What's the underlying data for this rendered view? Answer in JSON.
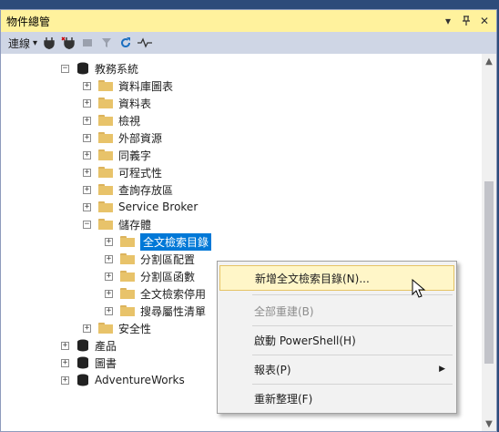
{
  "panel": {
    "title": "物件總管",
    "controls": {
      "dropdown": "▾",
      "pin": "ᵩ",
      "close": "✕"
    }
  },
  "toolbar": {
    "connect_label": "連線",
    "connect_caret": "▾"
  },
  "tree": {
    "db_name": "教務系統",
    "children": [
      "資料庫圖表",
      "資料表",
      "檢視",
      "外部資源",
      "同義字",
      "可程式性",
      "查詢存放區",
      "Service Broker"
    ],
    "storage": "儲存體",
    "storage_children": [
      "全文檢索目錄",
      "分割區配置",
      "分割區函數",
      "全文檢索停用",
      "搜尋屬性清單"
    ],
    "security": "安全性",
    "other_dbs": [
      "產品",
      "圖書",
      "AdventureWorks"
    ]
  },
  "context_menu": {
    "items": [
      {
        "label": "新增全文檢索目錄(N)...",
        "state": "hover"
      },
      {
        "label": "全部重建(B)",
        "state": "disabled"
      },
      {
        "label": "啟動 PowerShell(H)",
        "state": "normal"
      },
      {
        "label": "報表(P)",
        "state": "submenu"
      },
      {
        "label": "重新整理(F)",
        "state": "normal"
      }
    ]
  },
  "colors": {
    "selection": "#0078d7",
    "titlebar": "#fff29d",
    "folder": "#e8c36a"
  }
}
